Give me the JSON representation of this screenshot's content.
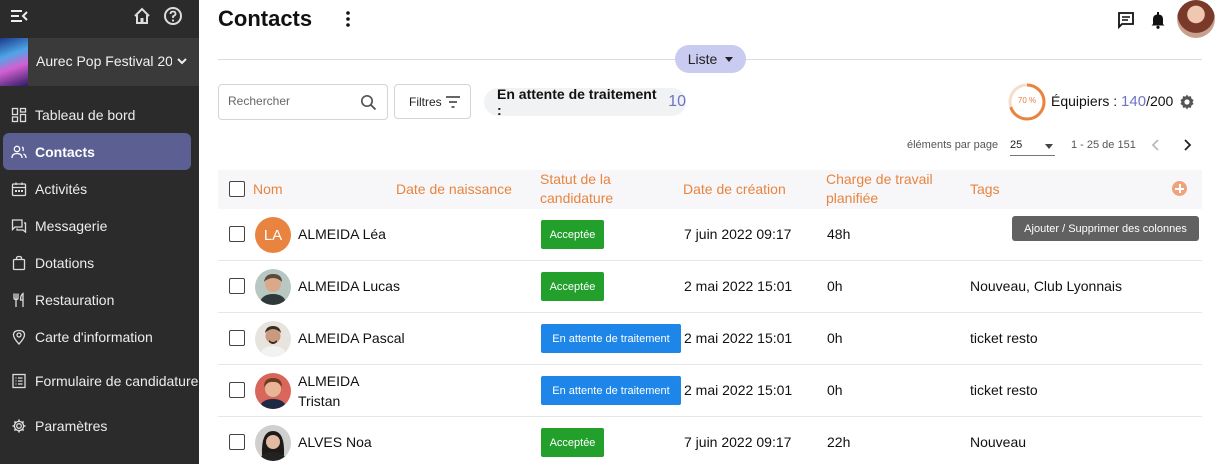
{
  "sidebar": {
    "event_name": "Aurec Pop Festival 20...",
    "items": [
      {
        "label": "Tableau de bord",
        "icon": "dashboard-icon"
      },
      {
        "label": "Contacts",
        "icon": "contacts-icon",
        "active": true
      },
      {
        "label": "Activités",
        "icon": "calendar-icon"
      },
      {
        "label": "Messagerie",
        "icon": "chat-icon"
      },
      {
        "label": "Dotations",
        "icon": "bag-icon"
      },
      {
        "label": "Restauration",
        "icon": "cutlery-icon"
      },
      {
        "label": "Carte d'information",
        "icon": "map-pin-icon"
      },
      {
        "label": "Formulaire de candidature",
        "icon": "form-icon"
      },
      {
        "label": "Paramètres",
        "icon": "gear-icon"
      }
    ]
  },
  "header": {
    "title": "Contacts",
    "view_label": "Liste"
  },
  "toolbar": {
    "search_placeholder": "Rechercher",
    "filters_label": "Filtres",
    "status_chip_label": "En attente de traitement :",
    "status_chip_count": "10",
    "gauge_percent": "70 %",
    "gauge_value": 0.7,
    "equip_label": "Équipiers :",
    "equip_count": "140",
    "equip_total": "/200"
  },
  "pagination": {
    "per_page_label": "éléments par page",
    "per_page_value": "25",
    "range": "1 - 25 de 151"
  },
  "table": {
    "headers": {
      "name": "Nom",
      "birth": "Date de naissance",
      "status": "Statut de la candidature",
      "created": "Date de création",
      "workload": "Charge de travail planifiée",
      "tags": "Tags"
    },
    "tooltip": "Ajouter / Supprimer des colonnes",
    "rows": [
      {
        "name": "ALMEIDA Léa",
        "initials": "LA",
        "status": "Acceptée",
        "created": "7 juin 2022 09:17",
        "workload": "48h",
        "tags": ""
      },
      {
        "name": "ALMEIDA Lucas",
        "status": "Acceptée",
        "created": "2 mai 2022 15:01",
        "workload": "0h",
        "tags": "Nouveau, Club Lyonnais"
      },
      {
        "name": "ALMEIDA Pascal",
        "status": "En attente de traitement",
        "created": "2 mai 2022 15:01",
        "workload": "0h",
        "tags": "ticket resto"
      },
      {
        "name": "ALMEIDA Tristan",
        "status": "En attente de traitement",
        "created": "2 mai 2022 15:01",
        "workload": "0h",
        "tags": "ticket resto"
      },
      {
        "name": "ALVES Noa",
        "status": "Acceptée",
        "created": "7 juin 2022 09:17",
        "workload": "22h",
        "tags": "Nouveau"
      }
    ]
  },
  "colors": {
    "accent_orange": "#e8843f",
    "accent_purple": "#6f73c6",
    "badge_accepted": "#22a02b",
    "badge_pending": "#1d86e8",
    "sidebar_bg": "#2b2b2b",
    "sidebar_active": "#5b5f92"
  }
}
